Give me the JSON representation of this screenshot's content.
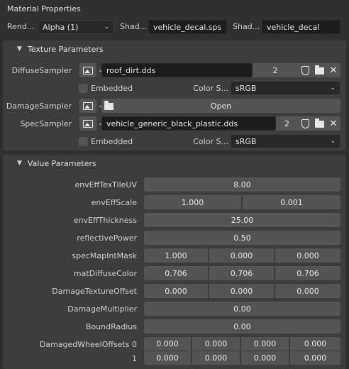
{
  "header": {
    "title": "Material Properties"
  },
  "topbar": {
    "render_label": "Rend...",
    "render_value": "Alpha (1)",
    "shader1_label": "Shad...",
    "shader1_value": "vehicle_decal.sps",
    "shader2_label": "Shad...",
    "shader2_value": "vehicle_decal"
  },
  "texture_params": {
    "title": "Texture Parameters",
    "diffuse": {
      "label": "DiffuseSampler",
      "file": "roof_dirt.dds",
      "count": "2"
    },
    "diffuse_opts": {
      "embedded_label": "Embedded",
      "color_label": "Color S...",
      "color_value": "sRGB"
    },
    "damage": {
      "label": "DamageSampler",
      "open_label": "Open"
    },
    "spec": {
      "label": "SpecSampler",
      "file": "vehicle_generic_black_plastic.dds",
      "count": "2"
    },
    "spec_opts": {
      "embedded_label": "Embedded",
      "color_label": "Color S...",
      "color_value": "sRGB"
    }
  },
  "value_params": {
    "title": "Value Parameters",
    "rows": {
      "envEffTexTileUV": {
        "label": "envEffTexTileUV",
        "values": [
          "8.00"
        ]
      },
      "envEffScale": {
        "label": "envEffScale",
        "values": [
          "1.000",
          "0.001"
        ]
      },
      "envEffThickness": {
        "label": "envEffThickness",
        "values": [
          "25.00"
        ]
      },
      "reflectivePower": {
        "label": "reflectivePower",
        "values": [
          "0.50"
        ]
      },
      "specMapIntMask": {
        "label": "specMapIntMask",
        "values": [
          "1.000",
          "0.000",
          "0.000"
        ]
      },
      "matDiffuseColor": {
        "label": "matDiffuseColor",
        "values": [
          "0.706",
          "0.706",
          "0.706"
        ]
      },
      "DamageTextureOffset": {
        "label": "DamageTextureOffset",
        "values": [
          "0.000",
          "0.000",
          "0.000"
        ]
      },
      "DamageMultiplier": {
        "label": "DamageMultiplier",
        "values": [
          "0.00"
        ]
      },
      "BoundRadius": {
        "label": "BoundRadius",
        "values": [
          "0.00"
        ]
      },
      "DamagedWheelOffsets": {
        "label0": "DamagedWheelOffsets 0",
        "label1": "1",
        "row0": [
          "0.000",
          "0.000",
          "0.000",
          "0.000"
        ],
        "row1": [
          "0.000",
          "0.000",
          "0.000",
          "0.000"
        ]
      }
    }
  }
}
